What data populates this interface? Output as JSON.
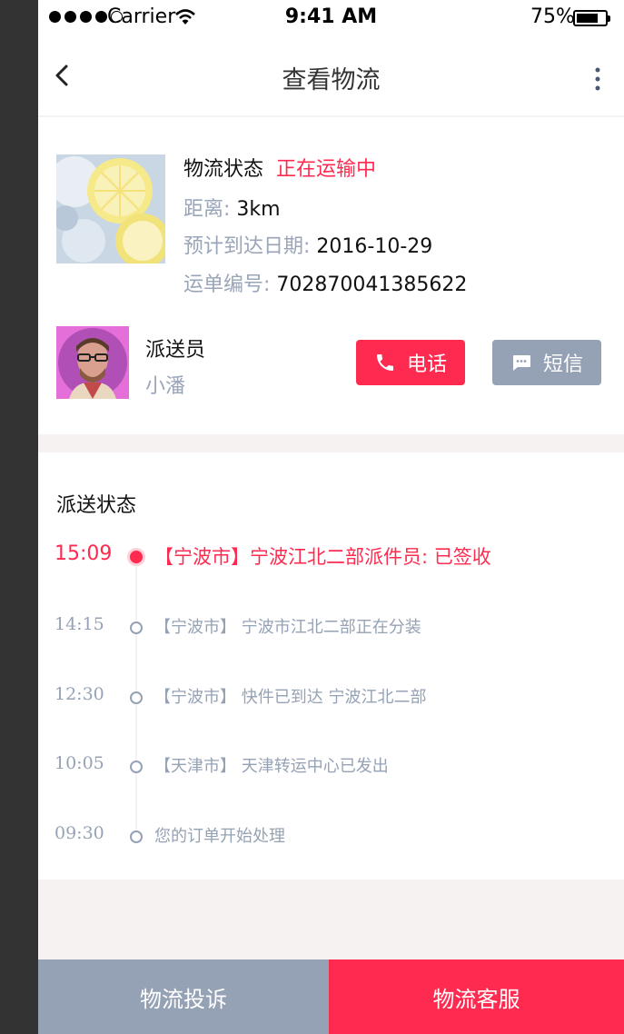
{
  "status_bar": {
    "carrier": "Carrier",
    "time": "9:41 AM",
    "battery_percent": "75%",
    "battery_level": 0.75
  },
  "nav": {
    "title": "查看物流",
    "back_icon": "chevron-left-icon",
    "more_icon": "more-vertical-icon"
  },
  "package": {
    "status_label": "物流状态",
    "status_value": "正在运输中",
    "distance_label": "距离:",
    "distance_value": "3km",
    "eta_label": "预计到达日期:",
    "eta_value": "2016-10-29",
    "waybill_label": "运单编号:",
    "waybill_value": "702870041385622"
  },
  "courier": {
    "title": "派送员",
    "name": "小潘",
    "call_label": "电话",
    "sms_label": "短信"
  },
  "timeline": {
    "title": "派送状态",
    "events": [
      {
        "time": "15:09",
        "desc": "【宁波市】宁波江北二部派件员: 已签收",
        "active": true
      },
      {
        "time": "14:15",
        "desc": "【宁波市】 宁波市江北二部正在分装",
        "active": false
      },
      {
        "time": "12:30",
        "desc": "【宁波市】 快件已到达 宁波江北二部",
        "active": false
      },
      {
        "time": "10:05",
        "desc": "【天津市】 天津转运中心已发出",
        "active": false
      },
      {
        "time": "09:30",
        "desc": "您的订单开始处理",
        "active": false
      }
    ]
  },
  "bottom": {
    "complaint_label": "物流投诉",
    "service_label": "物流客服"
  },
  "colors": {
    "accent": "#ff2a4f",
    "gray": "#95a2b5",
    "divider": "#f5f2f1"
  }
}
